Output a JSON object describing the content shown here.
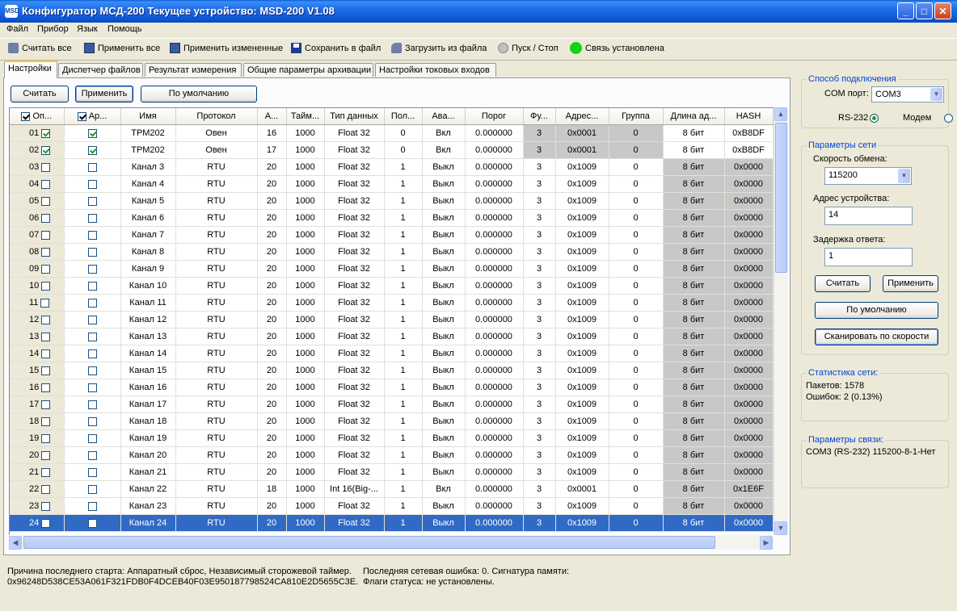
{
  "window": {
    "title": "Конфигуратор МСД-200   Текущее устройство: MSD-200 V1.08",
    "icon_text": "MSD"
  },
  "menu": [
    "Файл",
    "Прибор",
    "Язык",
    "Помощь"
  ],
  "toolbar": {
    "read_all": "Считать все",
    "apply_all": "Применить все",
    "apply_changed": "Применить измененные",
    "save_file": "Сохранить в файл",
    "load_file": "Загрузить из файла",
    "start_stop": "Пуск / Стоп",
    "connection_status": "Связь установлена",
    "status_color": "#12d412"
  },
  "tabs": [
    "Настройки",
    "Диспетчер файлов",
    "Результат измерения",
    "Общие параметры архивации",
    "Настройки токовых входов"
  ],
  "settings": {
    "read_button": "Считать",
    "apply_button": "Применить",
    "default_button": "По умолчанию"
  },
  "grid": {
    "columns": [
      "Оп...",
      "Ар...",
      "Имя",
      "Протокол",
      "А...",
      "Тайм...",
      "Тип данных",
      "Пол...",
      "Ава...",
      "Порог",
      "Фу...",
      "Адрес...",
      "Группа",
      "Длина ад...",
      "HASH"
    ],
    "rows": [
      {
        "num": "01",
        "op": true,
        "ar": true,
        "name": "ТРМ202",
        "protocol": "Овен",
        "a": "16",
        "timeout": "1000",
        "dtype": "Float 32",
        "pol": "0",
        "alarm": "Вкл",
        "threshold": "0.000000",
        "func": "3",
        "addr": "0x0001",
        "group": "0",
        "alen": "8 бит",
        "hash": "0xB8DF"
      },
      {
        "num": "02",
        "op": true,
        "ar": true,
        "name": "ТРМ202",
        "protocol": "Овен",
        "a": "17",
        "timeout": "1000",
        "dtype": "Float 32",
        "pol": "0",
        "alarm": "Вкл",
        "threshold": "0.000000",
        "func": "3",
        "addr": "0x0001",
        "group": "0",
        "alen": "8 бит",
        "hash": "0xB8DF"
      },
      {
        "num": "03",
        "op": false,
        "ar": false,
        "name": "Канал 3",
        "protocol": "RTU",
        "a": "20",
        "timeout": "1000",
        "dtype": "Float 32",
        "pol": "1",
        "alarm": "Выкл",
        "threshold": "0.000000",
        "func": "3",
        "addr": "0x1009",
        "group": "0",
        "alen": "8 бит",
        "hash": "0x0000"
      },
      {
        "num": "04",
        "op": false,
        "ar": false,
        "name": "Канал 4",
        "protocol": "RTU",
        "a": "20",
        "timeout": "1000",
        "dtype": "Float 32",
        "pol": "1",
        "alarm": "Выкл",
        "threshold": "0.000000",
        "func": "3",
        "addr": "0x1009",
        "group": "0",
        "alen": "8 бит",
        "hash": "0x0000"
      },
      {
        "num": "05",
        "op": false,
        "ar": false,
        "name": "Канал 5",
        "protocol": "RTU",
        "a": "20",
        "timeout": "1000",
        "dtype": "Float 32",
        "pol": "1",
        "alarm": "Выкл",
        "threshold": "0.000000",
        "func": "3",
        "addr": "0x1009",
        "group": "0",
        "alen": "8 бит",
        "hash": "0x0000"
      },
      {
        "num": "06",
        "op": false,
        "ar": false,
        "name": "Канал 6",
        "protocol": "RTU",
        "a": "20",
        "timeout": "1000",
        "dtype": "Float 32",
        "pol": "1",
        "alarm": "Выкл",
        "threshold": "0.000000",
        "func": "3",
        "addr": "0x1009",
        "group": "0",
        "alen": "8 бит",
        "hash": "0x0000"
      },
      {
        "num": "07",
        "op": false,
        "ar": false,
        "name": "Канал 7",
        "protocol": "RTU",
        "a": "20",
        "timeout": "1000",
        "dtype": "Float 32",
        "pol": "1",
        "alarm": "Выкл",
        "threshold": "0.000000",
        "func": "3",
        "addr": "0x1009",
        "group": "0",
        "alen": "8 бит",
        "hash": "0x0000"
      },
      {
        "num": "08",
        "op": false,
        "ar": false,
        "name": "Канал 8",
        "protocol": "RTU",
        "a": "20",
        "timeout": "1000",
        "dtype": "Float 32",
        "pol": "1",
        "alarm": "Выкл",
        "threshold": "0.000000",
        "func": "3",
        "addr": "0x1009",
        "group": "0",
        "alen": "8 бит",
        "hash": "0x0000"
      },
      {
        "num": "09",
        "op": false,
        "ar": false,
        "name": "Канал 9",
        "protocol": "RTU",
        "a": "20",
        "timeout": "1000",
        "dtype": "Float 32",
        "pol": "1",
        "alarm": "Выкл",
        "threshold": "0.000000",
        "func": "3",
        "addr": "0x1009",
        "group": "0",
        "alen": "8 бит",
        "hash": "0x0000"
      },
      {
        "num": "10",
        "op": false,
        "ar": false,
        "name": "Канал 10",
        "protocol": "RTU",
        "a": "20",
        "timeout": "1000",
        "dtype": "Float 32",
        "pol": "1",
        "alarm": "Выкл",
        "threshold": "0.000000",
        "func": "3",
        "addr": "0x1009",
        "group": "0",
        "alen": "8 бит",
        "hash": "0x0000"
      },
      {
        "num": "11",
        "op": false,
        "ar": false,
        "name": "Канал 11",
        "protocol": "RTU",
        "a": "20",
        "timeout": "1000",
        "dtype": "Float 32",
        "pol": "1",
        "alarm": "Выкл",
        "threshold": "0.000000",
        "func": "3",
        "addr": "0x1009",
        "group": "0",
        "alen": "8 бит",
        "hash": "0x0000"
      },
      {
        "num": "12",
        "op": false,
        "ar": false,
        "name": "Канал 12",
        "protocol": "RTU",
        "a": "20",
        "timeout": "1000",
        "dtype": "Float 32",
        "pol": "1",
        "alarm": "Выкл",
        "threshold": "0.000000",
        "func": "3",
        "addr": "0x1009",
        "group": "0",
        "alen": "8 бит",
        "hash": "0x0000"
      },
      {
        "num": "13",
        "op": false,
        "ar": false,
        "name": "Канал 13",
        "protocol": "RTU",
        "a": "20",
        "timeout": "1000",
        "dtype": "Float 32",
        "pol": "1",
        "alarm": "Выкл",
        "threshold": "0.000000",
        "func": "3",
        "addr": "0x1009",
        "group": "0",
        "alen": "8 бит",
        "hash": "0x0000"
      },
      {
        "num": "14",
        "op": false,
        "ar": false,
        "name": "Канал 14",
        "protocol": "RTU",
        "a": "20",
        "timeout": "1000",
        "dtype": "Float 32",
        "pol": "1",
        "alarm": "Выкл",
        "threshold": "0.000000",
        "func": "3",
        "addr": "0x1009",
        "group": "0",
        "alen": "8 бит",
        "hash": "0x0000"
      },
      {
        "num": "15",
        "op": false,
        "ar": false,
        "name": "Канал 15",
        "protocol": "RTU",
        "a": "20",
        "timeout": "1000",
        "dtype": "Float 32",
        "pol": "1",
        "alarm": "Выкл",
        "threshold": "0.000000",
        "func": "3",
        "addr": "0x1009",
        "group": "0",
        "alen": "8 бит",
        "hash": "0x0000"
      },
      {
        "num": "16",
        "op": false,
        "ar": false,
        "name": "Канал 16",
        "protocol": "RTU",
        "a": "20",
        "timeout": "1000",
        "dtype": "Float 32",
        "pol": "1",
        "alarm": "Выкл",
        "threshold": "0.000000",
        "func": "3",
        "addr": "0x1009",
        "group": "0",
        "alen": "8 бит",
        "hash": "0x0000"
      },
      {
        "num": "17",
        "op": false,
        "ar": false,
        "name": "Канал 17",
        "protocol": "RTU",
        "a": "20",
        "timeout": "1000",
        "dtype": "Float 32",
        "pol": "1",
        "alarm": "Выкл",
        "threshold": "0.000000",
        "func": "3",
        "addr": "0x1009",
        "group": "0",
        "alen": "8 бит",
        "hash": "0x0000"
      },
      {
        "num": "18",
        "op": false,
        "ar": false,
        "name": "Канал 18",
        "protocol": "RTU",
        "a": "20",
        "timeout": "1000",
        "dtype": "Float 32",
        "pol": "1",
        "alarm": "Выкл",
        "threshold": "0.000000",
        "func": "3",
        "addr": "0x1009",
        "group": "0",
        "alen": "8 бит",
        "hash": "0x0000"
      },
      {
        "num": "19",
        "op": false,
        "ar": false,
        "name": "Канал 19",
        "protocol": "RTU",
        "a": "20",
        "timeout": "1000",
        "dtype": "Float 32",
        "pol": "1",
        "alarm": "Выкл",
        "threshold": "0.000000",
        "func": "3",
        "addr": "0x1009",
        "group": "0",
        "alen": "8 бит",
        "hash": "0x0000"
      },
      {
        "num": "20",
        "op": false,
        "ar": false,
        "name": "Канал 20",
        "protocol": "RTU",
        "a": "20",
        "timeout": "1000",
        "dtype": "Float 32",
        "pol": "1",
        "alarm": "Выкл",
        "threshold": "0.000000",
        "func": "3",
        "addr": "0x1009",
        "group": "0",
        "alen": "8 бит",
        "hash": "0x0000"
      },
      {
        "num": "21",
        "op": false,
        "ar": false,
        "name": "Канал 21",
        "protocol": "RTU",
        "a": "20",
        "timeout": "1000",
        "dtype": "Float 32",
        "pol": "1",
        "alarm": "Выкл",
        "threshold": "0.000000",
        "func": "3",
        "addr": "0x1009",
        "group": "0",
        "alen": "8 бит",
        "hash": "0x0000"
      },
      {
        "num": "22",
        "op": false,
        "ar": false,
        "name": "Канал 22",
        "protocol": "RTU",
        "a": "18",
        "timeout": "1000",
        "dtype": "Int 16(Big-...",
        "pol": "1",
        "alarm": "Вкл",
        "threshold": "0.000000",
        "func": "3",
        "addr": "0x0001",
        "group": "0",
        "alen": "8 бит",
        "hash": "0x1E6F"
      },
      {
        "num": "23",
        "op": false,
        "ar": false,
        "name": "Канал 23",
        "protocol": "RTU",
        "a": "20",
        "timeout": "1000",
        "dtype": "Float 32",
        "pol": "1",
        "alarm": "Выкл",
        "threshold": "0.000000",
        "func": "3",
        "addr": "0x1009",
        "group": "0",
        "alen": "8 бит",
        "hash": "0x0000"
      },
      {
        "num": "24",
        "op": false,
        "ar": false,
        "name": "Канал 24",
        "protocol": "RTU",
        "a": "20",
        "timeout": "1000",
        "dtype": "Float 32",
        "pol": "1",
        "alarm": "Выкл",
        "threshold": "0.000000",
        "func": "3",
        "addr": "0x1009",
        "group": "0",
        "alen": "8 бит",
        "hash": "0x0000",
        "selected": true
      }
    ]
  },
  "connection_method": {
    "title": "Способ подключения",
    "com_label": "COM порт:",
    "com_value": "COM3",
    "rs232_label": "RS-232",
    "modem_label": "Модем"
  },
  "network_params": {
    "title": "Параметры сети",
    "baud_label": "Скорость обмена:",
    "baud_value": "115200",
    "addr_label": "Адрес устройства:",
    "addr_value": "14",
    "delay_label": "Задержка ответа:",
    "delay_value": "1",
    "read_button": "Считать",
    "apply_button": "Применить",
    "default_button": "По умолчанию",
    "scan_button": "Сканировать по скорости"
  },
  "net_stats": {
    "title": "Статистика сети:",
    "packets": "Пакетов: 1578",
    "errors": "Ошибок: 2 (0.13%)"
  },
  "link_params": {
    "title": "Параметры связи:",
    "value": "COM3 (RS-232)  115200-8-1-Нет"
  },
  "status": {
    "last_start": "Причина последнего старта: Аппаратный сброс, Независимый сторожевой таймер.",
    "hash_line": "0x96248D538CE53A061F321FDB0F4DCEB40F03E950187798524CA810E2D5655C3E.",
    "last_error": "Последняя сетевая ошибка: 0. Сигнатура памяти:",
    "status_flags": "Флаги статуса: не установлены."
  }
}
